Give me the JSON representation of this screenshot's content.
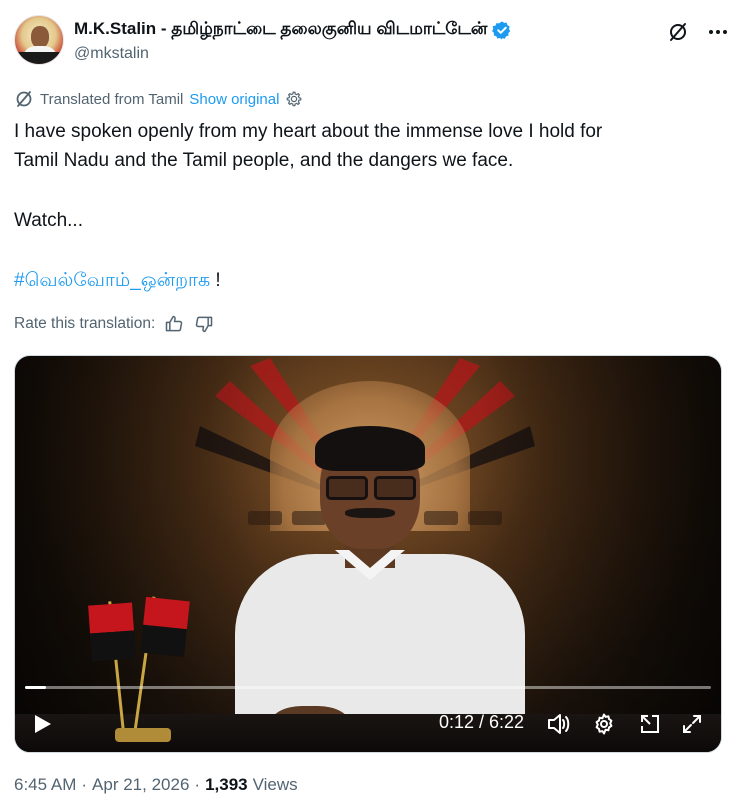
{
  "author": {
    "name": "M.K.Stalin - தமிழ்நாட்டை தலைகுனிய விடமாட்டேன்",
    "handle": "@mkstalin",
    "verified": true,
    "avatar_icon": "profile-photo"
  },
  "header_actions": {
    "grok_icon": "slash-circle-icon",
    "more_icon": "ellipsis-icon"
  },
  "translation": {
    "label": "Translated from Tamil",
    "show_original": "Show original",
    "settings_icon": "gear-icon"
  },
  "tweet": {
    "line1": "I have spoken openly from my heart about the immense love I hold for",
    "line2": "Tamil Nadu and the Tamil people, and the dangers we face.",
    "line3": "Watch...",
    "hashtag": "#வெல்வோம்_ஒன்றாக",
    "hashtag_suffix": " !"
  },
  "rate": {
    "label": "Rate this translation:",
    "like_icon": "thumbs-up-icon",
    "dislike_icon": "thumbs-down-icon"
  },
  "video": {
    "current_time": "0:12",
    "duration": "6:22",
    "time_display": "0:12 / 6:22",
    "progress_fraction": 0.031,
    "controls": [
      "play-icon",
      "volume-icon",
      "settings-icon",
      "pip-icon",
      "fullscreen-icon"
    ]
  },
  "meta": {
    "time": "6:45 AM",
    "separator": "·",
    "date": "Apr 21, 2026",
    "views_count": "1,393",
    "views_label": "Views"
  },
  "colors": {
    "link": "#1d9bf0",
    "secondary_text": "#536471",
    "primary_text": "#0f1419"
  }
}
